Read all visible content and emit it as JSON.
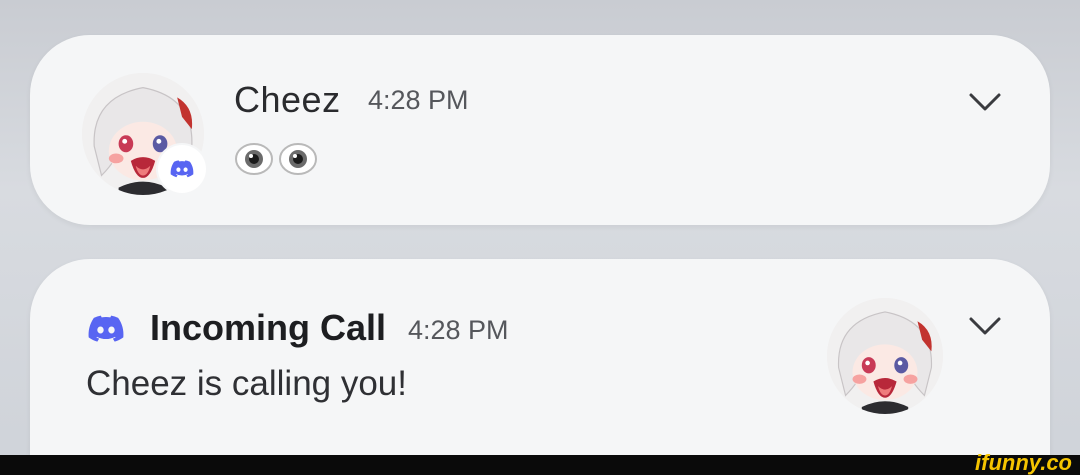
{
  "notification_message": {
    "sender": "Cheez",
    "time": "4:28 PM",
    "message_emoji": [
      "eye-emoji",
      "eye-emoji"
    ],
    "app_badge": "discord-icon"
  },
  "notification_call": {
    "title": "Incoming Call",
    "time": "4:28 PM",
    "message": "Cheez is calling you!",
    "app_icon": "discord-icon"
  },
  "colors": {
    "discord": "#5865F2",
    "card": "#f5f6f7"
  },
  "watermark": "ifunny.co"
}
